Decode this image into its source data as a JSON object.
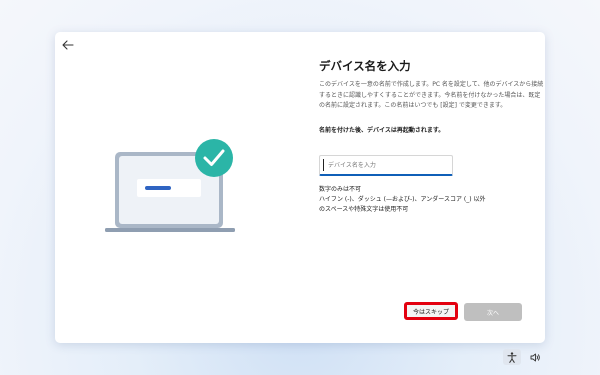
{
  "dialog": {
    "title": "デバイス名を入力",
    "description": "このデバイスを一意の名前で作成します。PC 名を設定して、他のデバイスから接続するときに認識しやすくすることができます。今名前を付けなかった場合は、既定の名前に設定されます。この名前はいつでも [設定] で変更できます。",
    "restart_note": "名前を付けた後、デバイスは再起動されます。",
    "name_input": {
      "placeholder": "デバイス名を入力",
      "value": ""
    },
    "rules": [
      "数字のみは不可",
      "ハイフン (-)、ダッシュ (—および-)、アンダースコア (_) 以外",
      "のスペースや特殊文字は使用不可"
    ],
    "skip_label": "今はスキップ",
    "next_label": "次へ"
  },
  "colors": {
    "accent": "#0f5fb8",
    "check_badge": "#2bb5a7",
    "highlight_border": "#e3000f",
    "disabled_button": "#bfbfbf"
  },
  "icons": {
    "back": "back-arrow-icon",
    "laptop": "laptop-illustration",
    "check": "checkmark-icon",
    "accessibility": "accessibility-icon",
    "volume": "volume-icon"
  }
}
